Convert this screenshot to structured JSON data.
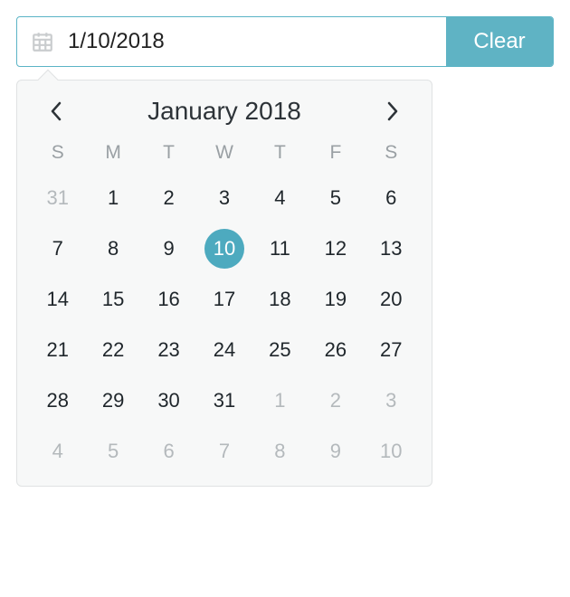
{
  "input": {
    "value": "1/10/2018",
    "placeholder": ""
  },
  "clear_label": "Clear",
  "month_title": "January 2018",
  "weekdays": [
    "S",
    "M",
    "T",
    "W",
    "T",
    "F",
    "S"
  ],
  "days": [
    {
      "n": 31,
      "faded": true,
      "selected": false
    },
    {
      "n": 1,
      "faded": false,
      "selected": false
    },
    {
      "n": 2,
      "faded": false,
      "selected": false
    },
    {
      "n": 3,
      "faded": false,
      "selected": false
    },
    {
      "n": 4,
      "faded": false,
      "selected": false
    },
    {
      "n": 5,
      "faded": false,
      "selected": false
    },
    {
      "n": 6,
      "faded": false,
      "selected": false
    },
    {
      "n": 7,
      "faded": false,
      "selected": false
    },
    {
      "n": 8,
      "faded": false,
      "selected": false
    },
    {
      "n": 9,
      "faded": false,
      "selected": false
    },
    {
      "n": 10,
      "faded": false,
      "selected": true
    },
    {
      "n": 11,
      "faded": false,
      "selected": false
    },
    {
      "n": 12,
      "faded": false,
      "selected": false
    },
    {
      "n": 13,
      "faded": false,
      "selected": false
    },
    {
      "n": 14,
      "faded": false,
      "selected": false
    },
    {
      "n": 15,
      "faded": false,
      "selected": false
    },
    {
      "n": 16,
      "faded": false,
      "selected": false
    },
    {
      "n": 17,
      "faded": false,
      "selected": false
    },
    {
      "n": 18,
      "faded": false,
      "selected": false
    },
    {
      "n": 19,
      "faded": false,
      "selected": false
    },
    {
      "n": 20,
      "faded": false,
      "selected": false
    },
    {
      "n": 21,
      "faded": false,
      "selected": false
    },
    {
      "n": 22,
      "faded": false,
      "selected": false
    },
    {
      "n": 23,
      "faded": false,
      "selected": false
    },
    {
      "n": 24,
      "faded": false,
      "selected": false
    },
    {
      "n": 25,
      "faded": false,
      "selected": false
    },
    {
      "n": 26,
      "faded": false,
      "selected": false
    },
    {
      "n": 27,
      "faded": false,
      "selected": false
    },
    {
      "n": 28,
      "faded": false,
      "selected": false
    },
    {
      "n": 29,
      "faded": false,
      "selected": false
    },
    {
      "n": 30,
      "faded": false,
      "selected": false
    },
    {
      "n": 31,
      "faded": false,
      "selected": false
    },
    {
      "n": 1,
      "faded": true,
      "selected": false
    },
    {
      "n": 2,
      "faded": true,
      "selected": false
    },
    {
      "n": 3,
      "faded": true,
      "selected": false
    },
    {
      "n": 4,
      "faded": true,
      "selected": false
    },
    {
      "n": 5,
      "faded": true,
      "selected": false
    },
    {
      "n": 6,
      "faded": true,
      "selected": false
    },
    {
      "n": 7,
      "faded": true,
      "selected": false
    },
    {
      "n": 8,
      "faded": true,
      "selected": false
    },
    {
      "n": 9,
      "faded": true,
      "selected": false
    },
    {
      "n": 10,
      "faded": true,
      "selected": false
    }
  ]
}
